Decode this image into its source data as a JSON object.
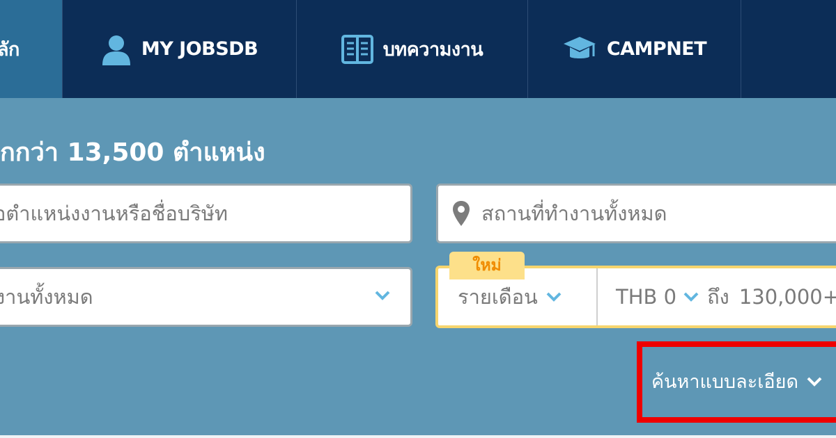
{
  "nav": {
    "active_label": "ลัก",
    "items": [
      {
        "label": "MY JOBSDB",
        "icon": "user-icon"
      },
      {
        "label": "บทความงาน",
        "icon": "book-icon"
      },
      {
        "label": "CAMPNET",
        "icon": "graduation-cap-icon"
      },
      {
        "label": ""
      }
    ]
  },
  "headline": "กกว่า 13,500 ตำแหน่ง",
  "search": {
    "keyword_placeholder": "อตำแหน่งงานหรือชื่อบริษัท",
    "location_placeholder": "สถานที่ทำงานทั้งหมด",
    "category_value": "งานทั้งหมด",
    "new_badge": "ใหม่",
    "salary_period": "รายเดือน",
    "salary_min": "THB 0",
    "salary_to": "ถึง",
    "salary_max": "130,000+",
    "advanced_label": "ค้นหาแบบละเอียด"
  },
  "colors": {
    "nav_bg": "#0c2d57",
    "nav_active": "#2b6d97",
    "page_bg": "#5e97b5",
    "icon_blue": "#62b6e0",
    "badge_bg": "#fde08a",
    "badge_text": "#f08c00",
    "highlight": "#ee0000"
  }
}
